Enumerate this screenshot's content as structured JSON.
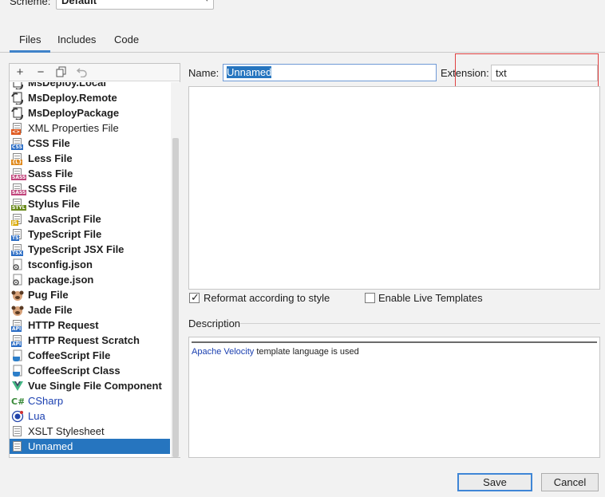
{
  "scheme": {
    "label": "Scheme:",
    "value": "Default"
  },
  "tabs": [
    {
      "label": "Files",
      "active": true
    },
    {
      "label": "Includes",
      "active": false
    },
    {
      "label": "Code",
      "active": false
    }
  ],
  "toolbar": {
    "add": "+",
    "remove": "−",
    "copy": "copy",
    "reset": "reset"
  },
  "templates": [
    {
      "label": "MsDeploy.Local",
      "bold": true,
      "icon": "msdeploy-icon"
    },
    {
      "label": "MsDeploy.Remote",
      "bold": true,
      "icon": "msdeploy-icon"
    },
    {
      "label": "MsDeployPackage",
      "bold": true,
      "icon": "msdeploy-icon"
    },
    {
      "label": "XML Properties File",
      "bold": false,
      "icon": "xml-file-icon"
    },
    {
      "label": "CSS File",
      "bold": true,
      "icon": "css-file-icon"
    },
    {
      "label": "Less File",
      "bold": true,
      "icon": "less-file-icon"
    },
    {
      "label": "Sass File",
      "bold": true,
      "icon": "sass-file-icon"
    },
    {
      "label": "SCSS File",
      "bold": true,
      "icon": "scss-file-icon"
    },
    {
      "label": "Stylus File",
      "bold": true,
      "icon": "stylus-file-icon"
    },
    {
      "label": "JavaScript File",
      "bold": true,
      "icon": "javascript-file-icon"
    },
    {
      "label": "TypeScript File",
      "bold": true,
      "icon": "typescript-file-icon"
    },
    {
      "label": "TypeScript JSX File",
      "bold": true,
      "icon": "tsx-file-icon"
    },
    {
      "label": "tsconfig.json",
      "bold": true,
      "icon": "json-config-icon"
    },
    {
      "label": "package.json",
      "bold": true,
      "icon": "json-config-icon"
    },
    {
      "label": "Pug File",
      "bold": true,
      "icon": "pug-icon"
    },
    {
      "label": "Jade File",
      "bold": true,
      "icon": "pug-icon"
    },
    {
      "label": "HTTP Request",
      "bold": true,
      "icon": "api-icon"
    },
    {
      "label": "HTTP Request Scratch",
      "bold": true,
      "icon": "api-icon"
    },
    {
      "label": "CoffeeScript File",
      "bold": true,
      "icon": "coffeescript-icon"
    },
    {
      "label": "CoffeeScript Class",
      "bold": true,
      "icon": "coffeescript-icon"
    },
    {
      "label": "Vue Single File Component",
      "bold": true,
      "icon": "vue-icon"
    },
    {
      "label": "CSharp",
      "bold": false,
      "link": true,
      "icon": "csharp-icon"
    },
    {
      "label": "Lua",
      "bold": false,
      "link": true,
      "icon": "lua-icon"
    },
    {
      "label": "XSLT Stylesheet",
      "bold": false,
      "icon": "xslt-file-icon"
    },
    {
      "label": "Unnamed",
      "bold": false,
      "selected": true,
      "icon": "text-file-icon"
    }
  ],
  "form": {
    "name_label": "Name:",
    "name_value": "Unnamed",
    "extension_label": "Extension:",
    "extension_value": "txt",
    "reformat_label": "Reformat according to style",
    "reformat_checked": true,
    "live_templates_label": "Enable Live Templates",
    "live_templates_checked": false
  },
  "description": {
    "label": "Description",
    "link_text": "Apache Velocity",
    "rest_text": " template language is used"
  },
  "buttons": {
    "save": "Save",
    "cancel": "Cancel"
  },
  "colors": {
    "accent": "#2675bf",
    "highlight_box": "#e04040"
  }
}
